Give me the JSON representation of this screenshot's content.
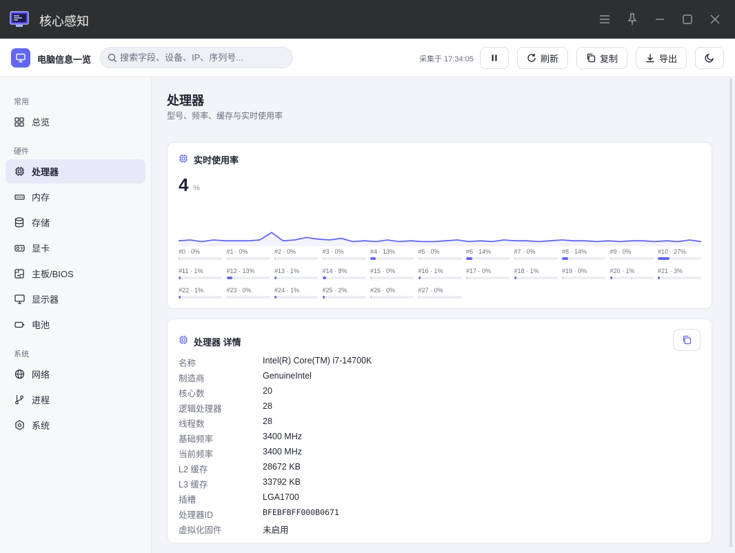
{
  "window": {
    "title": "核心感知"
  },
  "toolbar": {
    "name": "电脑信息一览",
    "search_placeholder": "搜索字段、设备、IP、序列号...",
    "collected": "采集于 17:34:05",
    "refresh": "刷新",
    "copy": "复制",
    "export": "导出"
  },
  "sidebar": {
    "sections": [
      "常用",
      "硬件",
      "系统"
    ],
    "items": [
      {
        "label": "总览",
        "icon": "grid-icon"
      },
      {
        "label": "处理器",
        "icon": "cpu-icon",
        "active": true
      },
      {
        "label": "内存",
        "icon": "memory-icon"
      },
      {
        "label": "存储",
        "icon": "database-icon"
      },
      {
        "label": "显卡",
        "icon": "gpu-icon"
      },
      {
        "label": "主板/BIOS",
        "icon": "board-icon"
      },
      {
        "label": "显示器",
        "icon": "monitor-icon"
      },
      {
        "label": "电池",
        "icon": "battery-icon"
      },
      {
        "label": "网络",
        "icon": "globe-icon"
      },
      {
        "label": "进程",
        "icon": "branch-icon"
      },
      {
        "label": "系统",
        "icon": "settings-icon"
      }
    ]
  },
  "page": {
    "title": "处理器",
    "subtitle": "型号、频率、缓存与实时使用率"
  },
  "usage_card": {
    "title": "实时使用率",
    "value": "4",
    "unit": "%",
    "accent": "#6366f1",
    "history": [
      4,
      5,
      3,
      5,
      4,
      4,
      4,
      5,
      14,
      4,
      5,
      8,
      6,
      5,
      7,
      3,
      4,
      3,
      5,
      3,
      4,
      3,
      3,
      4,
      5,
      3,
      4,
      3,
      5,
      4,
      4,
      3,
      4,
      5,
      4,
      4,
      3,
      4,
      3,
      4,
      4,
      3,
      4,
      3,
      5,
      3
    ]
  },
  "cores": [
    {
      "label": "#0 · 0%",
      "pct": 0
    },
    {
      "label": "#1 · 0%",
      "pct": 0
    },
    {
      "label": "#2 · 0%",
      "pct": 0
    },
    {
      "label": "#3 · 0%",
      "pct": 0
    },
    {
      "label": "#4 · 13%",
      "pct": 13
    },
    {
      "label": "#5 · 0%",
      "pct": 0
    },
    {
      "label": "#6 · 14%",
      "pct": 14
    },
    {
      "label": "#7 · 0%",
      "pct": 0
    },
    {
      "label": "#8 · 14%",
      "pct": 14
    },
    {
      "label": "#9 · 0%",
      "pct": 0
    },
    {
      "label": "#10 · 27%",
      "pct": 27
    },
    {
      "label": "#11 · 1%",
      "pct": 1
    },
    {
      "label": "#12 · 13%",
      "pct": 13
    },
    {
      "label": "#13 · 1%",
      "pct": 1
    },
    {
      "label": "#14 · 8%",
      "pct": 8
    },
    {
      "label": "#15 · 0%",
      "pct": 0
    },
    {
      "label": "#16 · 1%",
      "pct": 1
    },
    {
      "label": "#17 · 0%",
      "pct": 0
    },
    {
      "label": "#18 · 1%",
      "pct": 1
    },
    {
      "label": "#19 · 0%",
      "pct": 0
    },
    {
      "label": "#20 · 1%",
      "pct": 1
    },
    {
      "label": "#21 · 3%",
      "pct": 3
    },
    {
      "label": "#22 · 1%",
      "pct": 1
    },
    {
      "label": "#23 · 0%",
      "pct": 0
    },
    {
      "label": "#24 · 1%",
      "pct": 1
    },
    {
      "label": "#25 · 2%",
      "pct": 2
    },
    {
      "label": "#26 · 0%",
      "pct": 0
    },
    {
      "label": "#27 · 0%",
      "pct": 0
    }
  ],
  "details_card": {
    "title": "处理器 详情",
    "rows": [
      {
        "k": "名称",
        "v": "Intel(R) Core(TM) i7-14700K"
      },
      {
        "k": "制造商",
        "v": "GenuineIntel"
      },
      {
        "k": "核心数",
        "v": "20"
      },
      {
        "k": "逻辑处理器",
        "v": "28"
      },
      {
        "k": "线程数",
        "v": "28"
      },
      {
        "k": "基础频率",
        "v": "3400 MHz"
      },
      {
        "k": "当前频率",
        "v": "3400 MHz"
      },
      {
        "k": "L2 缓存",
        "v": "28672 KB"
      },
      {
        "k": "L3 缓存",
        "v": "33792 KB"
      },
      {
        "k": "插槽",
        "v": "LGA1700"
      },
      {
        "k": "处理器ID",
        "v": "BFEBFBFF000B0671",
        "mono": true
      },
      {
        "k": "虚拟化固件",
        "v": "未启用"
      }
    ]
  }
}
